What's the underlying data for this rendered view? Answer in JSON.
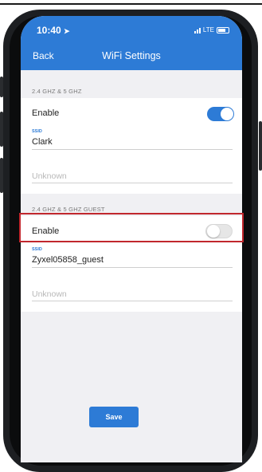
{
  "status_bar": {
    "time": "10:40",
    "carrier": "LTE"
  },
  "header": {
    "back_label": "Back",
    "title": "WiFi Settings"
  },
  "section_main": {
    "label": "2.4 GHZ & 5 GHZ",
    "enable_label": "Enable",
    "enabled": true,
    "ssid_label": "SSID",
    "ssid_value": "Clark",
    "password_placeholder": "Unknown"
  },
  "section_guest": {
    "label": "2.4 GHZ & 5 GHZ GUEST",
    "enable_label": "Enable",
    "enabled": false,
    "ssid_label": "SSID",
    "ssid_value": "Zyxel05858_guest",
    "password_placeholder": "Unknown"
  },
  "footer": {
    "save_label": "Save"
  },
  "colors": {
    "accent": "#2d7bd6",
    "highlight": "#c1272d",
    "background": "#f0f0f3"
  }
}
